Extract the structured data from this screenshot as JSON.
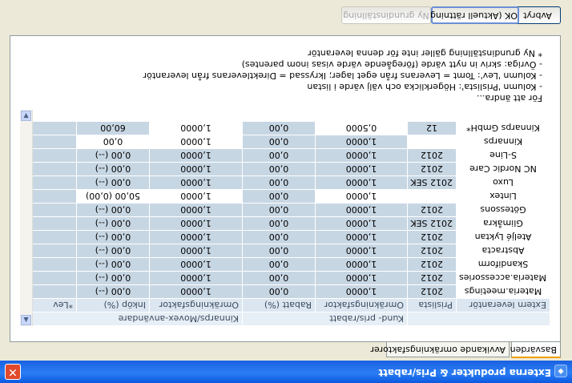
{
  "window": {
    "title": "Externa produkter & Pris/rabatt",
    "close_glyph": "✕"
  },
  "tabs": [
    {
      "label": "Basvärden",
      "active": true
    },
    {
      "label": "Avvikande omräkningsfaktorer",
      "active": false
    }
  ],
  "grid": {
    "group_headers": {
      "kund": "Kund- pris/rabatt",
      "kinnarps": "Kinnarps/Movex-användare"
    },
    "columns": [
      "Extern leverantör",
      "Prislista",
      "Omräkningsfaktor",
      "Rabatt (%)",
      "Omräkningsfaktor",
      "Inköp (%)",
      "*Lev"
    ],
    "rows": [
      [
        "Materia.meetings",
        "2012",
        "1,0000",
        "0,00",
        "1,0000",
        "0,00  (--)",
        ""
      ],
      [
        "Materia.accessories",
        "2012",
        "1,0000",
        "0,00",
        "1,0000",
        "0,00  (--)",
        ""
      ],
      [
        "Skandiform",
        "2012",
        "1,0000",
        "0,00",
        "1,0000",
        "0,00  (--)",
        ""
      ],
      [
        "Abstracta",
        "2012",
        "1,0000",
        "0,00",
        "1,0000",
        "0,00  (--)",
        ""
      ],
      [
        "Ateljé Lyktan",
        "2012",
        "1,0000",
        "0,00",
        "1,0000",
        "0,00  (--)",
        ""
      ],
      [
        "Glimåkra",
        "2012 SEK",
        "1,0000",
        "0,00",
        "1,0000",
        "0,00  (--)",
        ""
      ],
      [
        "Götessons",
        "2012",
        "1,0000",
        "0,00",
        "1,0000",
        "0,00  (--)",
        ""
      ],
      [
        "Lintex",
        "",
        "1,0000",
        "0,00",
        "1,0000",
        "50,00  (0,00)",
        ""
      ],
      [
        "Luxo",
        "2012 SEK",
        "1,0000",
        "0,00",
        "1,0000",
        "0,00  (--)",
        ""
      ],
      [
        "NC Nordic Care",
        "2012",
        "1,0000",
        "0,00",
        "1,0000",
        "0,00  (--)",
        ""
      ],
      [
        "S-Line",
        "2012",
        "1,0000",
        "0,00",
        "1,0000",
        "0,00  (--)",
        ""
      ],
      [
        "Kinnarps",
        "",
        "1,0000",
        "0,00",
        "1,0000",
        "0,00",
        ""
      ],
      [
        "Kinnarps GmbH*",
        "12",
        "0,5000",
        "0,00",
        "1,0000",
        "60,00",
        ""
      ]
    ]
  },
  "notes": [
    "För att ändra...",
    "- Kolumn 'Prislista': Högerklicka och välj värde i listan",
    "- Kolumn 'Lev': Tomt = Leverans från eget lager; Ikryssad = Direktleverans från leverantör",
    "- Övriga: skriv in nytt värde (föregående värde visas inom parentes)",
    "* Ny grundinställning gäller inte för denna leverantör"
  ],
  "buttons": {
    "cancel": "Avbryt",
    "ok": "OK (Aktuell rättning)",
    "reset": "Ny grundinställning"
  }
}
